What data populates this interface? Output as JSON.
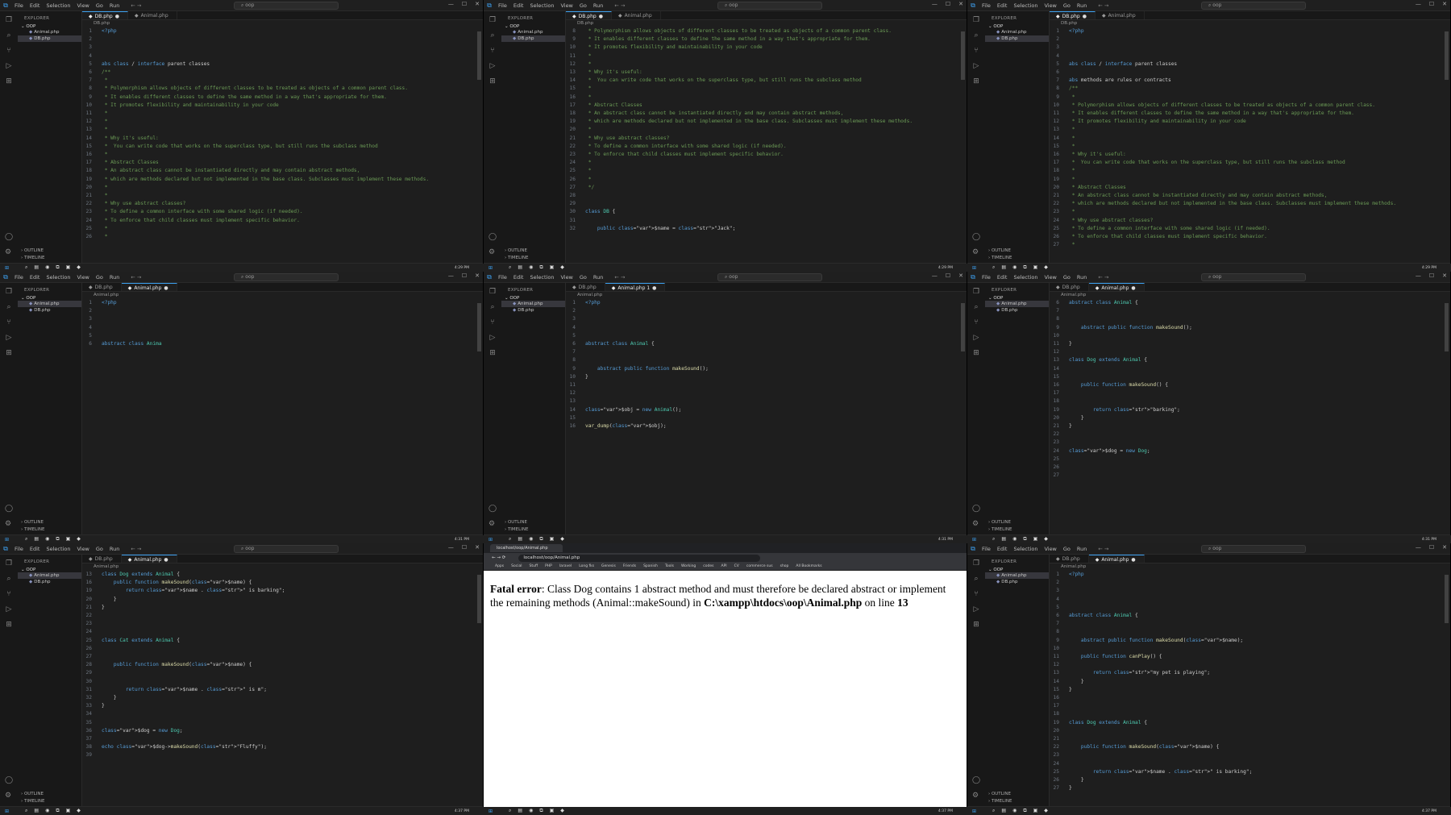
{
  "vscode": {
    "menu": [
      "File",
      "Edit",
      "Selection",
      "View",
      "Go",
      "Run"
    ],
    "search": "oop",
    "explorer": "EXPLORER",
    "folder": "OOP",
    "files": [
      "Animal.php",
      "DB.php"
    ],
    "outline": "OUTLINE",
    "timeline": "TIMELINE"
  },
  "panels": [
    {
      "tabs": [
        "DB.php",
        "Animal.php"
      ],
      "active": 0,
      "breadcrumb": "DB.php",
      "status": [
        "Ln 5, Col 10 (5 selected)",
        "Spaces: 4",
        "UTF-8",
        "CRLF",
        "PHP"
      ],
      "lines": [
        [
          "1",
          "<?php"
        ],
        [
          "2",
          ""
        ],
        [
          "3",
          ""
        ],
        [
          "4",
          ""
        ],
        [
          "5",
          "abs class / interface parent classes"
        ],
        [
          "6",
          "/**"
        ],
        [
          "7",
          " *"
        ],
        [
          "8",
          " * Polymorphism allows objects of different classes to be treated as objects of a common parent class."
        ],
        [
          "9",
          " * It enables different classes to define the same method in a way that's appropriate for them."
        ],
        [
          "10",
          " * It promotes flexibility and maintainability in your code"
        ],
        [
          "11",
          " *"
        ],
        [
          "12",
          " *"
        ],
        [
          "13",
          " *"
        ],
        [
          "14",
          " * Why it's useful:"
        ],
        [
          "15",
          " *  You can write code that works on the superclass type, but still runs the subclass method"
        ],
        [
          "16",
          " *"
        ],
        [
          "17",
          " * Abstract Classes"
        ],
        [
          "18",
          " * An abstract class cannot be instantiated directly and may contain abstract methods,"
        ],
        [
          "19",
          " * which are methods declared but not implemented in the base class. Subclasses must implement these methods."
        ],
        [
          "20",
          " *"
        ],
        [
          "21",
          " *"
        ],
        [
          "22",
          " * Why use abstract classes?"
        ],
        [
          "23",
          " * To define a common interface with some shared logic (if needed)."
        ],
        [
          "24",
          " * To enforce that child classes must implement specific behavior."
        ],
        [
          "25",
          " *"
        ],
        [
          "26",
          " *"
        ]
      ]
    },
    {
      "tabs": [
        "DB.php",
        "Animal.php"
      ],
      "active": 0,
      "breadcrumb": "DB.php",
      "status": [
        "Ln 5, Col 8 (6 selected)",
        "Spaces: 4",
        "UTF-8",
        "CRLF",
        "PHP"
      ],
      "lines": [
        [
          "8",
          " * Polymorphism allows objects of different classes to be treated as objects of a common parent class."
        ],
        [
          "9",
          " * It enables different classes to define the same method in a way that's appropriate for them."
        ],
        [
          "10",
          " * It promotes flexibility and maintainability in your code"
        ],
        [
          "11",
          " *"
        ],
        [
          "12",
          " *"
        ],
        [
          "13",
          " * Why it's useful:"
        ],
        [
          "14",
          " *  You can write code that works on the superclass type, but still runs the subclass method"
        ],
        [
          "15",
          " *"
        ],
        [
          "16",
          " *"
        ],
        [
          "17",
          " * Abstract Classes"
        ],
        [
          "18",
          " * An abstract class cannot be instantiated directly and may contain abstract methods,"
        ],
        [
          "19",
          " * which are methods declared but not implemented in the base class. Subclasses must implement these methods."
        ],
        [
          "20",
          " *"
        ],
        [
          "21",
          " * Why use abstract classes?"
        ],
        [
          "22",
          " * To define a common interface with some shared logic (if needed)."
        ],
        [
          "23",
          " * To enforce that child classes must implement specific behavior."
        ],
        [
          "24",
          " *"
        ],
        [
          "25",
          " *"
        ],
        [
          "26",
          " *"
        ],
        [
          "27",
          " */"
        ],
        [
          "28",
          ""
        ],
        [
          "29",
          ""
        ],
        [
          "30",
          "class DB {"
        ],
        [
          "31",
          ""
        ],
        [
          "32",
          "    public $name = \"Jack\";"
        ]
      ]
    },
    {
      "tabs": [
        "DB.php",
        "Animal.php"
      ],
      "active": 0,
      "breadcrumb": "DB.php",
      "status": [
        "Ln 10, Col 24",
        "Spaces: 4",
        "UTF-8",
        "CRLF",
        "PHP"
      ],
      "lines": [
        [
          "1",
          "<?php"
        ],
        [
          "2",
          ""
        ],
        [
          "3",
          ""
        ],
        [
          "4",
          ""
        ],
        [
          "5",
          "abs class / interface parent classes"
        ],
        [
          "6",
          ""
        ],
        [
          "7",
          "abs methods are rules or contracts"
        ],
        [
          "8",
          "/**"
        ],
        [
          "9",
          " *"
        ],
        [
          "10",
          " * Polymorphism allows objects of different classes to be treated as objects of a common parent class."
        ],
        [
          "11",
          " * It enables different classes to define the same method in a way that's appropriate for them."
        ],
        [
          "12",
          " * It promotes flexibility and maintainability in your code"
        ],
        [
          "13",
          " *"
        ],
        [
          "14",
          " *"
        ],
        [
          "15",
          " *"
        ],
        [
          "16",
          " * Why it's useful:"
        ],
        [
          "17",
          " *  You can write code that works on the superclass type, but still runs the subclass method"
        ],
        [
          "18",
          " *"
        ],
        [
          "19",
          " *"
        ],
        [
          "20",
          " * Abstract Classes"
        ],
        [
          "21",
          " * An abstract class cannot be instantiated directly and may contain abstract methods,"
        ],
        [
          "22",
          " * which are methods declared but not implemented in the base class. Subclasses must implement these methods."
        ],
        [
          "23",
          " *"
        ],
        [
          "24",
          " * Why use abstract classes?"
        ],
        [
          "25",
          " * To define a common interface with some shared logic (if needed)."
        ],
        [
          "26",
          " * To enforce that child classes must implement specific behavior."
        ],
        [
          "27",
          " *"
        ]
      ]
    },
    {
      "tabs": [
        "DB.php",
        "Animal.php"
      ],
      "active": 1,
      "breadcrumb": "Animal.php",
      "status": [
        "Ln 6, Col 21",
        "Spaces: 4",
        "UTF-8",
        "CRLF",
        "PHP"
      ],
      "lines": [
        [
          "1",
          "<?php"
        ],
        [
          "2",
          ""
        ],
        [
          "3",
          ""
        ],
        [
          "4",
          ""
        ],
        [
          "5",
          ""
        ],
        [
          "6",
          "abstract class Anima"
        ]
      ]
    },
    {
      "tabs": [
        "DB.php",
        "Animal.php 1"
      ],
      "active": 1,
      "breadcrumb": "Animal.php",
      "status": [
        "Ln 9, Col 42",
        "Spaces: 4",
        "UTF-8",
        "CRLF",
        "PHP"
      ],
      "lines": [
        [
          "1",
          "<?php"
        ],
        [
          "2",
          ""
        ],
        [
          "3",
          ""
        ],
        [
          "4",
          ""
        ],
        [
          "5",
          ""
        ],
        [
          "6",
          "abstract class Animal {"
        ],
        [
          "7",
          ""
        ],
        [
          "8",
          ""
        ],
        [
          "9",
          "    abstract public function makeSound();"
        ],
        [
          "10",
          "}"
        ],
        [
          "11",
          ""
        ],
        [
          "12",
          ""
        ],
        [
          "13",
          ""
        ],
        [
          "14",
          "$obj = new Animal();"
        ],
        [
          "15",
          ""
        ],
        [
          "16",
          "var_dump($obj);"
        ]
      ]
    },
    {
      "tabs": [
        "DB.php",
        "Animal.php"
      ],
      "active": 1,
      "breadcrumb": "Animal.php",
      "status": [
        "Ln 26, Col 1",
        "Spaces: 4",
        "UTF-8",
        "CRLF",
        "PHP"
      ],
      "lines": [
        [
          "6",
          "abstract class Animal {"
        ],
        [
          "7",
          ""
        ],
        [
          "8",
          ""
        ],
        [
          "9",
          "    abstract public function makeSound();"
        ],
        [
          "10",
          ""
        ],
        [
          "11",
          "}"
        ],
        [
          "12",
          ""
        ],
        [
          "13",
          "class Dog extends Animal {"
        ],
        [
          "14",
          ""
        ],
        [
          "15",
          ""
        ],
        [
          "16",
          "    public function makeSound() {"
        ],
        [
          "17",
          ""
        ],
        [
          "18",
          ""
        ],
        [
          "19",
          "        return \"barking\";"
        ],
        [
          "20",
          "    }"
        ],
        [
          "21",
          "}"
        ],
        [
          "22",
          ""
        ],
        [
          "23",
          ""
        ],
        [
          "24",
          "$dog = new Dog;"
        ],
        [
          "25",
          ""
        ],
        [
          "26",
          ""
        ],
        [
          "27",
          ""
        ]
      ]
    },
    {
      "tabs": [
        "DB.php",
        "Animal.php"
      ],
      "active": 1,
      "breadcrumb": "Animal.php",
      "status": [
        "Ln 31, Col 30",
        "Spaces: 4",
        "UTF-8",
        "CRLF",
        "PHP"
      ],
      "lines": [
        [
          "13",
          "class Dog extends Animal {"
        ],
        [
          "16",
          "    public function makeSound($name) {"
        ],
        [
          "19",
          "        return $name . \" is barking\";"
        ],
        [
          "20",
          "    }"
        ],
        [
          "21",
          "}"
        ],
        [
          "22",
          ""
        ],
        [
          "23",
          ""
        ],
        [
          "24",
          ""
        ],
        [
          "25",
          "class Cat extends Animal {"
        ],
        [
          "26",
          ""
        ],
        [
          "27",
          ""
        ],
        [
          "28",
          "    public function makeSound($name) {"
        ],
        [
          "29",
          ""
        ],
        [
          "30",
          ""
        ],
        [
          "31",
          "        return $name . \" is m\";"
        ],
        [
          "32",
          "    }"
        ],
        [
          "33",
          "}"
        ],
        [
          "34",
          ""
        ],
        [
          "35",
          ""
        ],
        [
          "36",
          "$dog = new Dog;"
        ],
        [
          "37",
          ""
        ],
        [
          "38",
          "echo $dog->makeSound(\"Fluffy\");"
        ],
        [
          "39",
          ""
        ]
      ]
    },
    {
      "browser": true,
      "tab": "localhost/oop/Animal.php",
      "url": "localhost/oop/Animal.php",
      "bookmarks": [
        "Apps",
        "Social",
        "Stuff",
        "PHP",
        "laravel",
        "Long fks",
        "Genesis",
        "Friends",
        "Spanish",
        "Tools",
        "Working",
        "codes",
        "API",
        "CV",
        "commerce sus",
        "shop",
        "All Bookmarks"
      ],
      "error_label": "Fatal error",
      "error_text": ": Class Dog contains 1 abstract method and must therefore be declared abstract or implement the remaining methods (Animal::makeSound) in ",
      "error_path": "C:\\xampp\\htdocs\\oop\\Animal.php",
      "error_online": " on line ",
      "error_line": "13"
    },
    {
      "tabs": [
        "DB.php",
        "Animal.php"
      ],
      "active": 1,
      "breadcrumb": "Animal.php",
      "status": [
        "Ln 15, Col 2",
        "Spaces: 4",
        "UTF-8",
        "CRLF",
        "PHP"
      ],
      "lines": [
        [
          "1",
          "<?php"
        ],
        [
          "2",
          ""
        ],
        [
          "3",
          ""
        ],
        [
          "4",
          ""
        ],
        [
          "5",
          ""
        ],
        [
          "6",
          "abstract class Animal {"
        ],
        [
          "7",
          ""
        ],
        [
          "8",
          ""
        ],
        [
          "9",
          "    abstract public function makeSound($name);"
        ],
        [
          "10",
          ""
        ],
        [
          "11",
          "    public function canPlay() {"
        ],
        [
          "12",
          ""
        ],
        [
          "13",
          "        return \"my pet is playing\";"
        ],
        [
          "14",
          "    }"
        ],
        [
          "15",
          "}"
        ],
        [
          "16",
          ""
        ],
        [
          "17",
          ""
        ],
        [
          "18",
          ""
        ],
        [
          "19",
          "class Dog extends Animal {"
        ],
        [
          "20",
          ""
        ],
        [
          "21",
          ""
        ],
        [
          "22",
          "    public function makeSound($name) {"
        ],
        [
          "23",
          ""
        ],
        [
          "24",
          ""
        ],
        [
          "25",
          "        return $name . \" is barking\";"
        ],
        [
          "26",
          "    }"
        ],
        [
          "27",
          "}"
        ]
      ]
    }
  ],
  "taskbar": {
    "clock": [
      "4:29 PM",
      "4:31 PM",
      "4:37 PM"
    ]
  },
  "colors": {
    "editor_bg": "#1e1e1e",
    "accent": "#0078d4",
    "keyword": "#569cd6",
    "class": "#4ec9b0",
    "function": "#dcdcaa",
    "string": "#ce9178",
    "variable": "#9cdcfe",
    "comment": "#6a9955"
  }
}
